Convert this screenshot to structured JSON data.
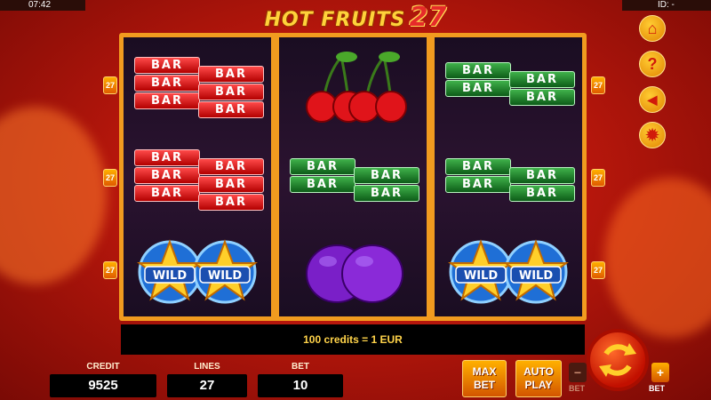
{
  "status": {
    "time": "07:42",
    "id_label": "ID: -"
  },
  "title": {
    "text": "HOT FRUITS",
    "number": "27"
  },
  "line_markers": {
    "left": [
      "27",
      "27",
      "27"
    ],
    "right": [
      "27",
      "27",
      "27"
    ]
  },
  "reels": [
    {
      "symbols": [
        "bar-red",
        "bar-red",
        "wild"
      ]
    },
    {
      "symbols": [
        "cherries",
        "bar-green",
        "plum"
      ]
    },
    {
      "symbols": [
        "bar-green",
        "bar-green",
        "wild"
      ]
    }
  ],
  "symbol_text": {
    "bar": "BAR",
    "wild": "WILD"
  },
  "side_menu": [
    {
      "icon": "home-icon",
      "glyph": "⌂"
    },
    {
      "icon": "help-icon",
      "glyph": "?"
    },
    {
      "icon": "sound-icon",
      "glyph": "◀"
    },
    {
      "icon": "settings-icon",
      "glyph": "✹"
    }
  ],
  "info": {
    "text": "100 credits = 1 EUR"
  },
  "credit": {
    "label": "CREDIT",
    "value": "9525"
  },
  "lines": {
    "label": "LINES",
    "value": "27"
  },
  "bet": {
    "label": "BET",
    "value": "10"
  },
  "buttons": {
    "max_bet": [
      "MAX",
      "BET"
    ],
    "auto_play": [
      "AUTO",
      "PLAY"
    ],
    "bet_minus": "−",
    "bet_plus": "+",
    "bet_minus_label": "BET",
    "bet_plus_label": "BET",
    "spin_icon": "spin-icon"
  },
  "colors": {
    "accent": "#f19b1f",
    "background": "#c01e0e",
    "info_text": "#ffd34a"
  }
}
